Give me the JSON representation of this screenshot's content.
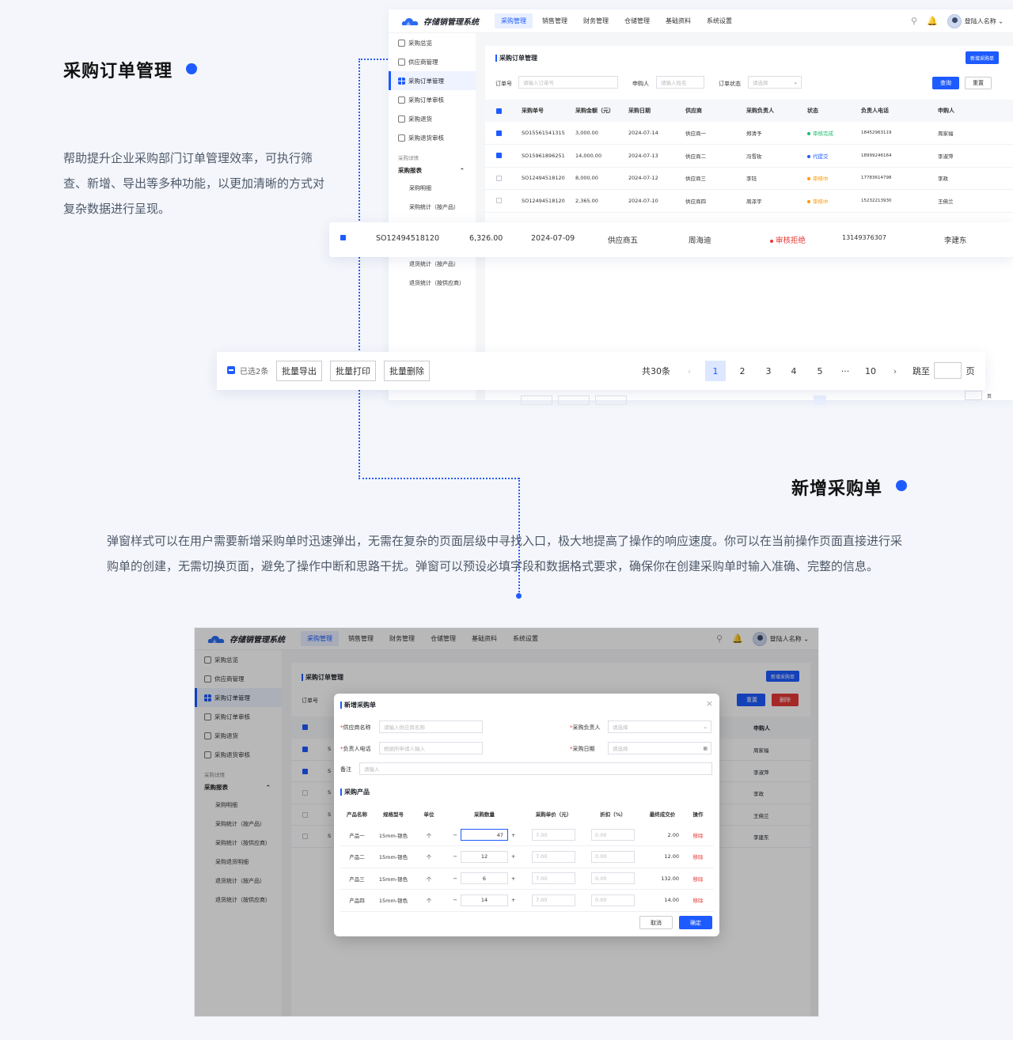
{
  "section1": {
    "title": "采购订单管理",
    "desc": "帮助提升企业采购部门订单管理效率，可执行筛查、新增、导出等多种功能，以更加清晰的方式对复杂数据进行呈现。"
  },
  "section2": {
    "title": "新增采购单",
    "desc": "弹窗样式可以在用户需要新增采购单时迅速弹出，无需在复杂的页面层级中寻找入口，极大地提高了操作的响应速度。你可以在当前操作页面直接进行采购单的创建，无需切换页面，避免了操作中断和思路干扰。弹窗可以预设必填字段和数据格式要求，确保你在创建采购单时输入准确、完整的信息。"
  },
  "app": {
    "logo": "存储销管理系统",
    "menu": [
      "采购管理",
      "销售管理",
      "财务管理",
      "仓储管理",
      "基础资料",
      "系统设置"
    ],
    "user": "登陆人名称",
    "sidebar": {
      "items": [
        "采购总览",
        "供应商管理",
        "采购订单管理",
        "采购订单审核",
        "采购退货",
        "采购退货审核"
      ],
      "group": "采购详情",
      "report": "采购报表",
      "subs1": [
        "采购明细",
        "采购统计（按产品）"
      ],
      "subs2": [
        "采购明细",
        "采购统计（按产品）",
        "采购统计（按供应商）",
        "采购退货明细",
        "退货统计（按产品）",
        "退货统计（按供应商）"
      ],
      "subs_tail": [
        "退货统计（按产品）",
        "退货统计（按供应商）"
      ]
    },
    "page_title": "采购订单管理",
    "new_btn": "新增采购单",
    "filters": {
      "order_no": "订单号",
      "order_no_ph": "请输入订单号",
      "applicant": "申购人",
      "applicant_ph": "请输入姓名",
      "status": "订单状态",
      "status_ph": "请选择"
    },
    "query_btn": "查询",
    "reset_btn": "重置",
    "delete_btn": "删除",
    "columns": [
      "采购单号",
      "采购金额（元）",
      "采购日期",
      "供应商",
      "采购负责人",
      "状态",
      "负责人电话",
      "申购人"
    ],
    "rows": [
      {
        "no": "SO15561541315",
        "amount": "3,000.00",
        "date": "2024-07-14",
        "supplier": "供应商一",
        "owner": "郑清予",
        "status": "审核完成",
        "phone": "18452963119",
        "applicant": "周家福",
        "checked": true
      },
      {
        "no": "SO15961896251",
        "amount": "14,000.00",
        "date": "2024-07-13",
        "supplier": "供应商二",
        "owner": "冯雪玫",
        "status": "代提交",
        "phone": "18999246164",
        "applicant": "李淑萍",
        "checked": true
      },
      {
        "no": "SO12494518120",
        "amount": "8,000.00",
        "date": "2024-07-12",
        "supplier": "供应商三",
        "owner": "李钰",
        "status": "审核中",
        "phone": "17783614798",
        "applicant": "李政",
        "checked": false
      },
      {
        "no": "SO12494518120",
        "amount": "2,365.00",
        "date": "2024-07-10",
        "supplier": "供应商四",
        "owner": "周泽宇",
        "status": "审核中",
        "phone": "15232213930",
        "applicant": "王佛兰",
        "checked": false
      }
    ],
    "highlight_row": {
      "no": "SO12494518120",
      "amount": "6,326.00",
      "date": "2024-07-09",
      "supplier": "供应商五",
      "owner": "周海迪",
      "status": "审核拒绝",
      "phone": "13149376307",
      "applicant": "李建东"
    },
    "bulk": {
      "selected": "已选2条",
      "export": "批量导出",
      "print": "批量打印",
      "delete": "批量删除"
    },
    "pagination": {
      "total": "共30条",
      "pages": [
        "1",
        "2",
        "3",
        "4",
        "5",
        "···",
        "10"
      ],
      "jump": "跳至",
      "page_unit": "页"
    },
    "status_colors": {
      "审核完成": "#19be6b",
      "代提交": "#1e5bff",
      "审核中": "#ff9900",
      "审核拒绝": "#e53935"
    }
  },
  "app2": {
    "applicants": [
      "周家福",
      "李淑萍",
      "李政",
      "王佛兰",
      "李建东"
    ],
    "head_applicant": "申购人",
    "row_prefix": "S"
  },
  "modal": {
    "title": "新增采购单",
    "supplier_label": "供应商名称",
    "supplier_ph": "请输入供应商名称",
    "owner_label": "采购负责人",
    "owner_ph": "请选择",
    "phone_label": "负责人电话",
    "phone_ph": "根据所申请人输入",
    "date_label": "采购日期",
    "date_ph": "请选择",
    "note_label": "备注",
    "note_ph": "请输入",
    "products_title": "采购产品",
    "columns": [
      "产品名称",
      "规格型号",
      "单位",
      "采购数量",
      "采购单价（元）",
      "折扣（%）",
      "最终成交价",
      "操作"
    ],
    "rows": [
      {
        "name": "产品一",
        "spec": "15mm-银色",
        "unit": "个",
        "qty": "47",
        "price": "7.00",
        "discount": "0.00",
        "final": "2.00",
        "op": "移除"
      },
      {
        "name": "产品二",
        "spec": "15mm-银色",
        "unit": "个",
        "qty": "12",
        "price": "7.00",
        "discount": "0.00",
        "final": "12.00",
        "op": "移除"
      },
      {
        "name": "产品三",
        "spec": "15mm-银色",
        "unit": "个",
        "qty": "6",
        "price": "7.00",
        "discount": "0.00",
        "final": "132.00",
        "op": "移除"
      },
      {
        "name": "产品四",
        "spec": "15mm-银色",
        "unit": "个",
        "qty": "14",
        "price": "7.00",
        "discount": "0.00",
        "final": "14.00",
        "op": "移除"
      }
    ],
    "cancel": "取消",
    "confirm": "确定"
  }
}
